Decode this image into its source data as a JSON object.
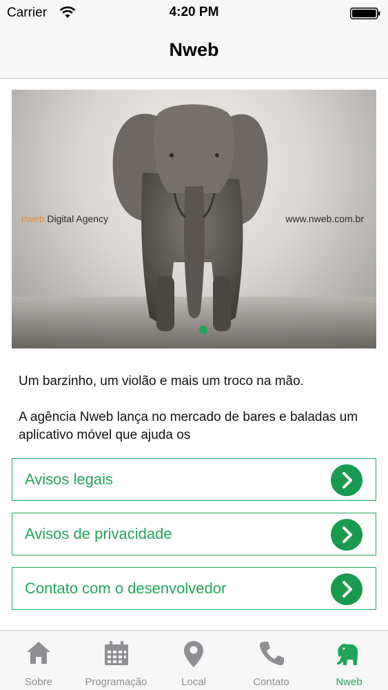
{
  "status_bar": {
    "carrier": "Carrier",
    "time": "4:20 PM",
    "wifi_icon": "wifi-icon",
    "battery_icon": "battery-full-icon"
  },
  "nav": {
    "title": "Nweb"
  },
  "hero": {
    "caption_brand": "nweb",
    "caption_rest": " Digital Agency",
    "caption_url": "www.nweb.com.br",
    "brand_color": "#e8893a",
    "page_indicator": {
      "current": 1,
      "total": 1
    }
  },
  "description": {
    "paragraphs": [
      "Um barzinho, um violão e mais um troco na mão.",
      "A agência Nweb lança no mercado de bares e baladas um aplicativo móvel que ajuda os"
    ]
  },
  "links": [
    {
      "label": "Avisos legais",
      "icon": "chevron-right-icon"
    },
    {
      "label": "Avisos de privacidade",
      "icon": "chevron-right-icon"
    },
    {
      "label": "Contato com o desenvolvedor",
      "icon": "chevron-right-icon"
    }
  ],
  "tabs": [
    {
      "label": "Sobre",
      "icon": "home-icon",
      "active": false
    },
    {
      "label": "Programação",
      "icon": "calendar-icon",
      "active": false
    },
    {
      "label": "Local",
      "icon": "map-pin-icon",
      "active": false
    },
    {
      "label": "Contato",
      "icon": "phone-icon",
      "active": false
    },
    {
      "label": "Nweb",
      "icon": "elephant-icon",
      "active": true
    }
  ],
  "colors": {
    "accent": "#1fa65a",
    "tab_inactive": "#8e8e93",
    "bar_background": "#f7f7f7"
  }
}
